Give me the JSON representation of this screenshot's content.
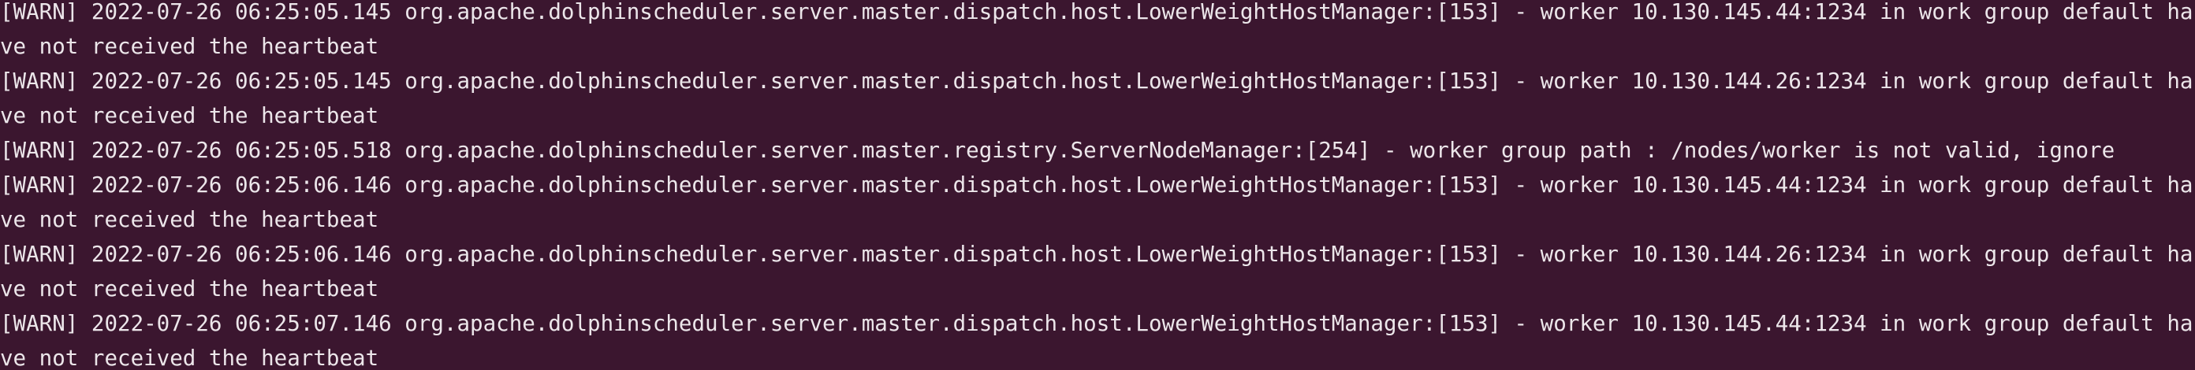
{
  "terminal": {
    "lines": [
      "[WARN] 2022-07-26 06:25:05.145 org.apache.dolphinscheduler.server.master.dispatch.host.LowerWeightHostManager:[153] - worker 10.130.145.44:1234 in work group default have not received the heartbeat",
      "[WARN] 2022-07-26 06:25:05.145 org.apache.dolphinscheduler.server.master.dispatch.host.LowerWeightHostManager:[153] - worker 10.130.144.26:1234 in work group default have not received the heartbeat",
      "[WARN] 2022-07-26 06:25:05.518 org.apache.dolphinscheduler.server.master.registry.ServerNodeManager:[254] - worker group path : /nodes/worker is not valid, ignore",
      "[WARN] 2022-07-26 06:25:06.146 org.apache.dolphinscheduler.server.master.dispatch.host.LowerWeightHostManager:[153] - worker 10.130.145.44:1234 in work group default have not received the heartbeat",
      "[WARN] 2022-07-26 06:25:06.146 org.apache.dolphinscheduler.server.master.dispatch.host.LowerWeightHostManager:[153] - worker 10.130.144.26:1234 in work group default have not received the heartbeat",
      "[WARN] 2022-07-26 06:25:07.146 org.apache.dolphinscheduler.server.master.dispatch.host.LowerWeightHostManager:[153] - worker 10.130.145.44:1234 in work group default have not received the heartbeat"
    ]
  },
  "colors": {
    "background": "#3b162f",
    "text": "#ece6ea"
  }
}
